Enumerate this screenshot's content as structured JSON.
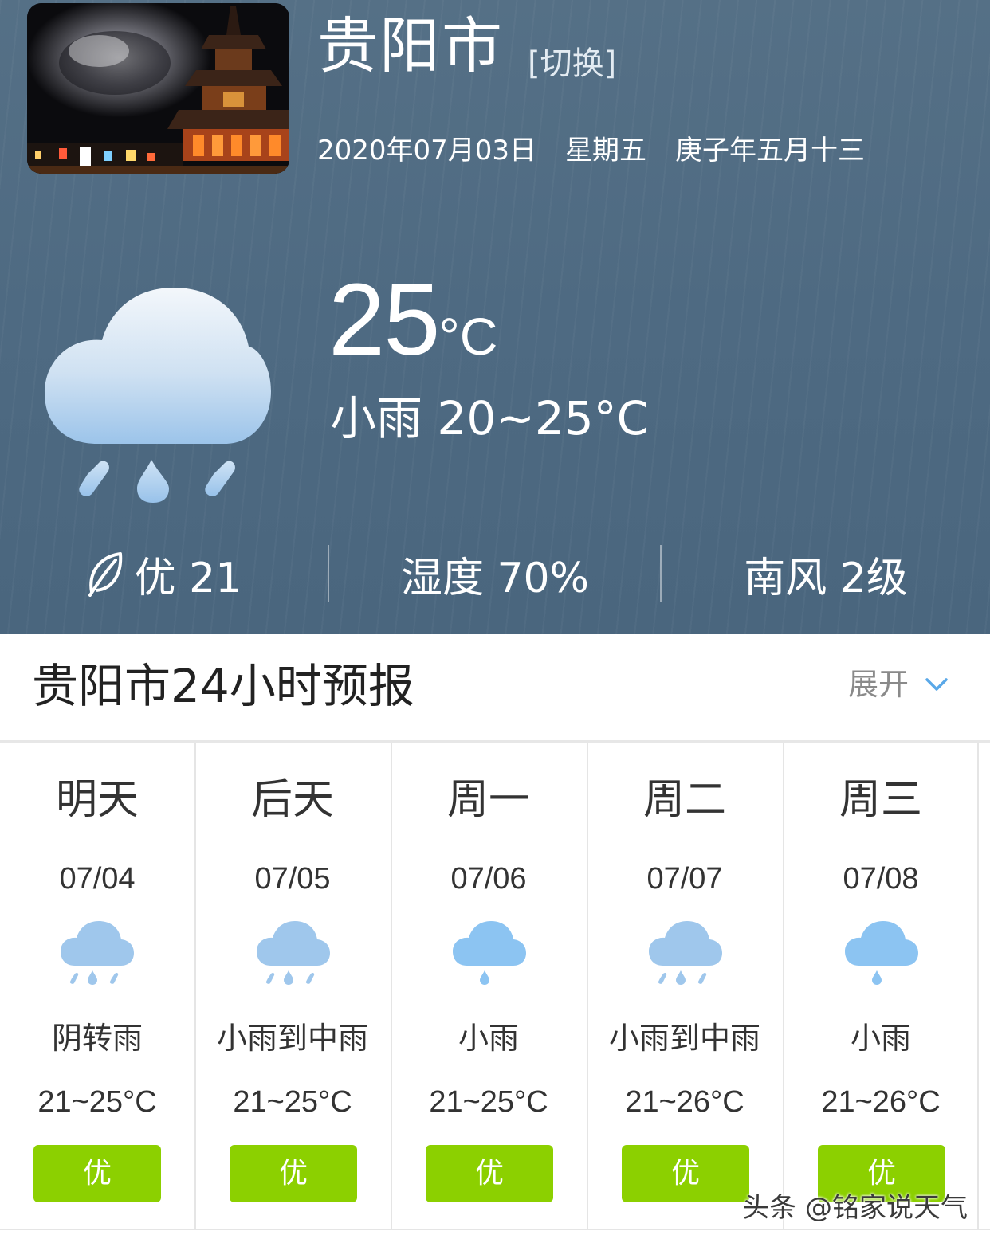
{
  "header": {
    "city": "贵阳市",
    "switch_label": "[切换]",
    "date": "2020年07月03日",
    "weekday": "星期五",
    "lunar_date": "庚子年五月十三"
  },
  "current": {
    "temperature": "25",
    "unit": "°C",
    "description_range": "小雨 20~25°C",
    "icon": "rain-cloud-icon",
    "aqi": "优 21",
    "humidity": "湿度 70%",
    "wind": "南风 2级"
  },
  "forecast": {
    "title": "贵阳市24小时预报",
    "expand_label": "展开",
    "days": [
      {
        "name": "明天",
        "date": "07/04",
        "desc": "阴转雨",
        "range": "21~25°C",
        "aqi": "优",
        "icon": "rain-cloud-icon"
      },
      {
        "name": "后天",
        "date": "07/05",
        "desc": "小雨到中雨",
        "range": "21~25°C",
        "aqi": "优",
        "icon": "rain-cloud-icon"
      },
      {
        "name": "周一",
        "date": "07/06",
        "desc": "小雨",
        "range": "21~25°C",
        "aqi": "优",
        "icon": "light-rain-cloud-icon"
      },
      {
        "name": "周二",
        "date": "07/07",
        "desc": "小雨到中雨",
        "range": "21~26°C",
        "aqi": "优",
        "icon": "rain-cloud-icon"
      },
      {
        "name": "周三",
        "date": "07/08",
        "desc": "小雨",
        "range": "21~26°C",
        "aqi": "优",
        "icon": "light-rain-cloud-icon"
      }
    ]
  },
  "watermark": "头条 @铭家说天气",
  "colors": {
    "hero_bg": "#506b83",
    "aqi_good": "#8cd000",
    "cloud_light": "#9dc8ee"
  }
}
